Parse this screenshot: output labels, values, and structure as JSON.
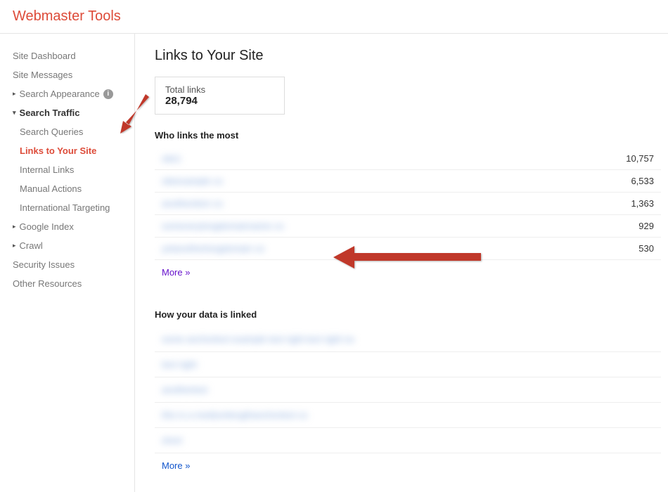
{
  "header": {
    "title": "Webmaster Tools"
  },
  "sidebar": {
    "items": [
      {
        "label": "Site Dashboard",
        "type": "plain"
      },
      {
        "label": "Site Messages",
        "type": "plain"
      },
      {
        "label": "Search Appearance",
        "type": "expandable",
        "hasInfo": true
      },
      {
        "label": "Search Traffic",
        "type": "expanded",
        "bold": true
      },
      {
        "label": "Search Queries",
        "type": "sub"
      },
      {
        "label": "Links to Your Site",
        "type": "sub",
        "active": true
      },
      {
        "label": "Internal Links",
        "type": "sub"
      },
      {
        "label": "Manual Actions",
        "type": "sub"
      },
      {
        "label": "International Targeting",
        "type": "sub"
      },
      {
        "label": "Google Index",
        "type": "expandable"
      },
      {
        "label": "Crawl",
        "type": "expandable"
      },
      {
        "label": "Security Issues",
        "type": "plain"
      },
      {
        "label": "Other Resources",
        "type": "plain"
      }
    ]
  },
  "main": {
    "pageTitle": "Links to Your Site",
    "totalLinksLabel": "Total links",
    "totalLinksValue": "28,794",
    "whoLinksTitle": "Who links the most",
    "whoLinks": [
      {
        "domain": "site1",
        "count": "10,757"
      },
      {
        "domain": "siteexample co",
        "count": "6,533"
      },
      {
        "domain": "anotherdom co",
        "count": "1,363"
      },
      {
        "domain": "someverylongdomainname co",
        "count": "929"
      },
      {
        "domain": "yetanotherlongdomain co",
        "count": "530"
      }
    ],
    "moreLabel": "More »",
    "howLinkedTitle": "How your data is linked",
    "howLinked": [
      {
        "text": "some anchortext example text right text right no"
      },
      {
        "text": "text right"
      },
      {
        "text": "anothertext"
      },
      {
        "text": "this is a mediumlengthanchortext co"
      },
      {
        "text": "short"
      }
    ],
    "moreLabel2": "More »"
  }
}
